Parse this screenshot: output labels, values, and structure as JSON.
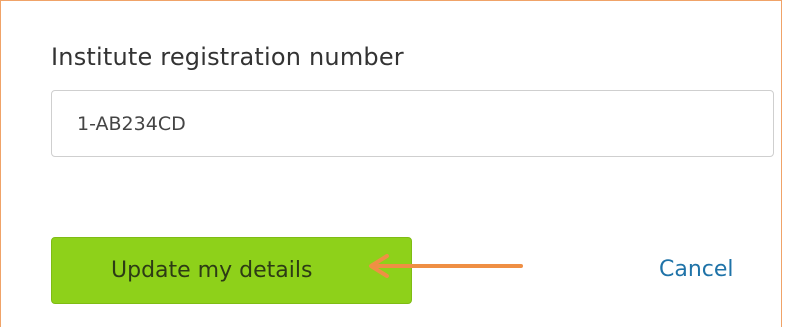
{
  "form": {
    "field_label": "Institute registration number",
    "field_value": "1-AB234CD",
    "update_button_label": "Update my details",
    "cancel_label": "Cancel"
  },
  "colors": {
    "panel_border": "#f0a368",
    "button_green": "#8ed11a",
    "arrow_orange": "#ef8f44",
    "link_blue": "#1f73a8"
  },
  "annotation": {
    "arrow_icon": "arrow-left-icon"
  }
}
